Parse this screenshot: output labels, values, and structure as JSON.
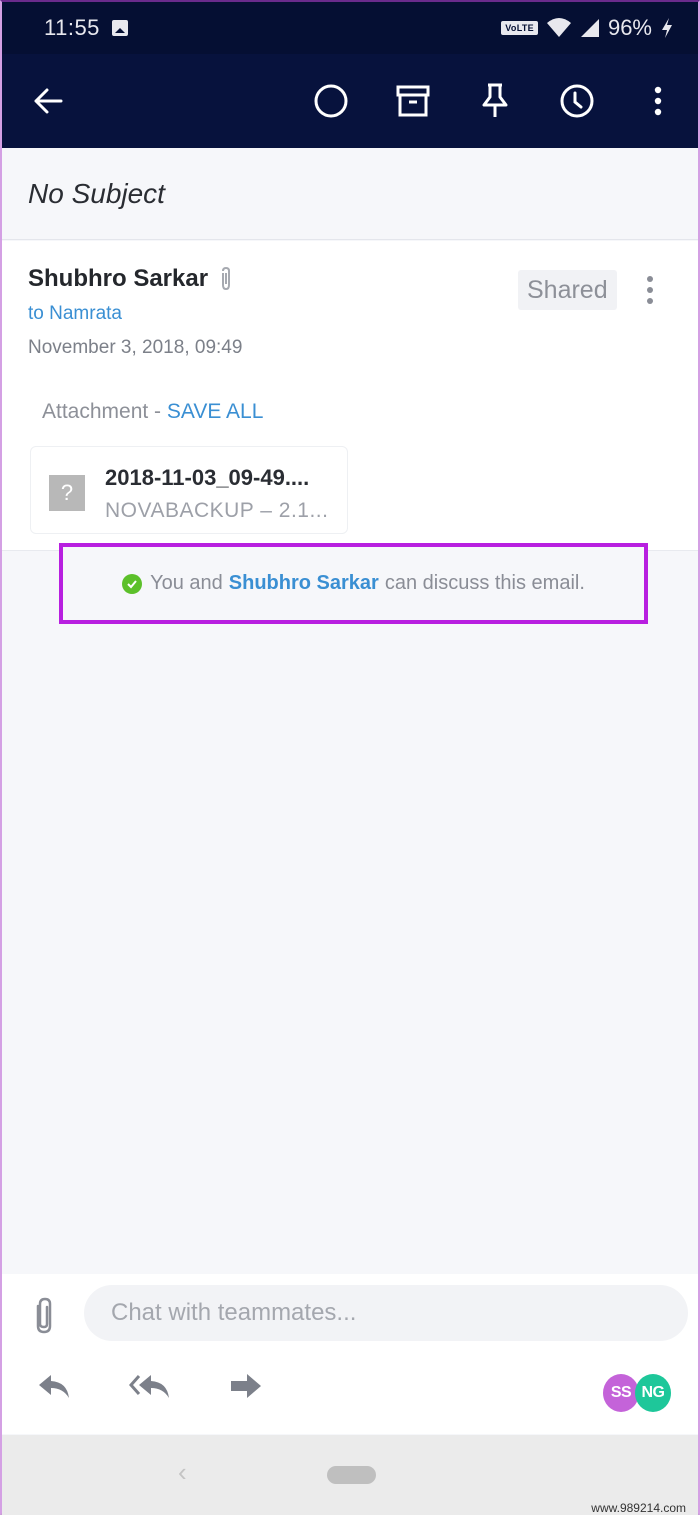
{
  "status_bar": {
    "time": "11:55",
    "network_badge": "VoLTE",
    "battery": "96%",
    "icons": [
      "image-icon",
      "wifi-icon",
      "signal-icon",
      "charging-icon"
    ]
  },
  "app_bar": {
    "icons": [
      "back-arrow-icon",
      "mark-unread-circle-icon",
      "archive-icon",
      "pin-icon",
      "snooze-clock-icon",
      "more-vertical-icon"
    ]
  },
  "email": {
    "subject": "No Subject",
    "sender": "Shubhro Sarkar",
    "to_line": "to Namrata",
    "date": "November 3, 2018, 09:49",
    "shared_label": "Shared",
    "attachment_label": "Attachment - ",
    "save_all_label": "SAVE ALL",
    "attachment": {
      "file_icon_glyph": "?",
      "file_name": "2018-11-03_09-49....",
      "file_sub": "NOVABACKUP – 2.1..."
    }
  },
  "discussion": {
    "prefix": "You and",
    "person": "Shubhro Sarkar",
    "suffix": "can discuss this email."
  },
  "composer": {
    "placeholder": "Chat with teammates...",
    "actions": [
      "reply",
      "reply-all",
      "forward"
    ],
    "avatars": [
      {
        "initials": "SS",
        "color": "#c463d9"
      },
      {
        "initials": "NG",
        "color": "#1ec79a"
      }
    ]
  },
  "nav_bar": {
    "back_glyph": "‹"
  },
  "watermark": "www.989214.com",
  "colors": {
    "app_bar": "#07123d",
    "link_blue": "#3a8fd3",
    "highlight_border": "#b81fe0",
    "status_green": "#5cc02a"
  }
}
